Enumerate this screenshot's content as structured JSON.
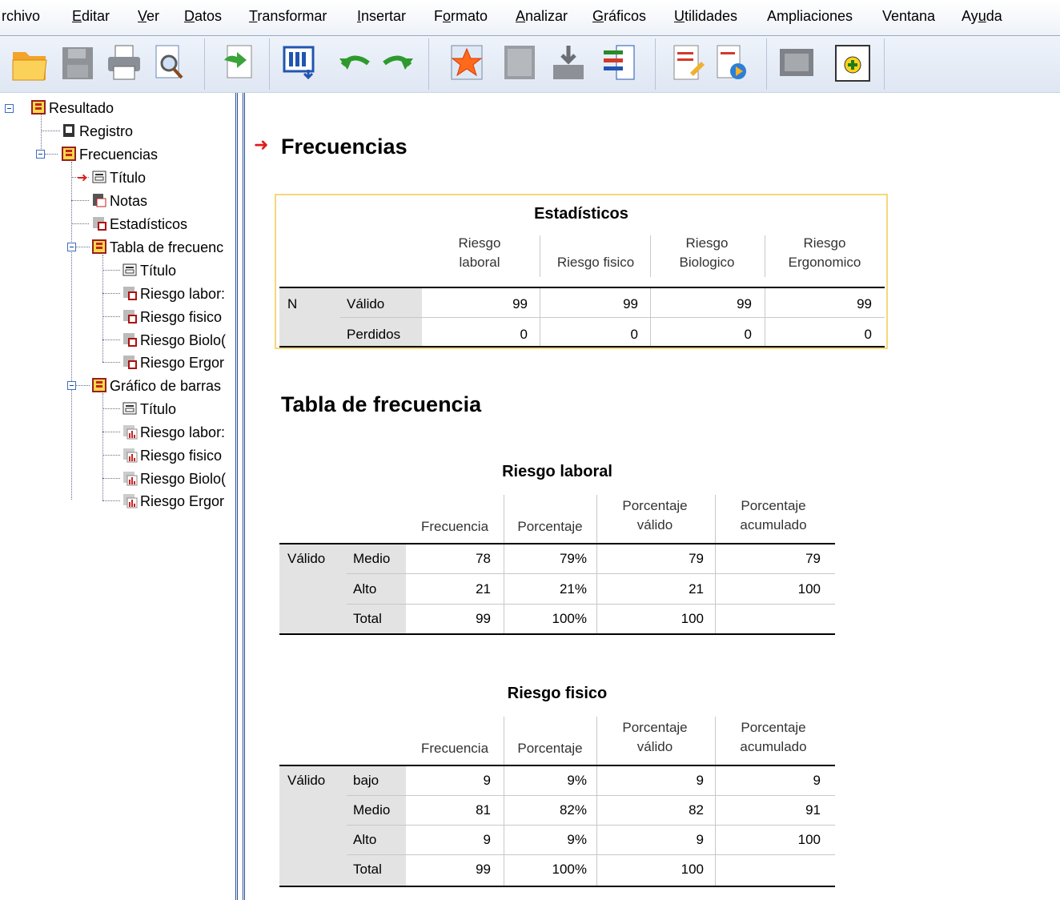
{
  "menu": [
    "rchivo",
    "Editar",
    "Ver",
    "Datos",
    "Transformar",
    "Insertar",
    "Formato",
    "Analizar",
    "Gráficos",
    "Utilidades",
    "Ampliaciones",
    "Ventana",
    "Ayuda"
  ],
  "toolbar_icons": [
    "open-folder-icon",
    "save-icon",
    "print-icon",
    "print-preview-icon",
    "export-icon",
    "recall-dialog-icon",
    "undo-icon",
    "redo-icon",
    "goto-data-icon",
    "goto-case-icon",
    "goto-variable-icon",
    "variables-icon",
    "create-title-icon",
    "insert-text-icon",
    "designate-window-icon",
    "add-icon"
  ],
  "tree": {
    "root": "Resultado",
    "log": "Registro",
    "freq": "Frecuencias",
    "title": "Título",
    "notes": "Notas",
    "stats": "Estadísticos",
    "freq_table": "Tabla de frecuenc",
    "ft_title": "Título",
    "ft_items": [
      "Riesgo labor:",
      "Riesgo fisico",
      "Riesgo Biolo(",
      "Riesgo Ergor"
    ],
    "bar_chart": "Gráfico de barras",
    "bc_title": "Título",
    "bc_items": [
      "Riesgo labor:",
      "Riesgo fisico",
      "Riesgo Biolo(",
      "Riesgo Ergor"
    ]
  },
  "output": {
    "heading": "Frecuencias",
    "stats": {
      "title": "Estadísticos",
      "cols": [
        "Riesgo laboral",
        "Riesgo fisico",
        "Riesgo Biologico",
        "Riesgo Ergonomico"
      ],
      "row_group": "N",
      "rows": [
        {
          "label": "Válido",
          "values": [
            "99",
            "99",
            "99",
            "99"
          ]
        },
        {
          "label": "Perdidos",
          "values": [
            "0",
            "0",
            "0",
            "0"
          ]
        }
      ]
    },
    "freq_heading": "Tabla de frecuencia",
    "col_headers": [
      "Frecuencia",
      "Porcentaje",
      "Porcentaje válido",
      "Porcentaje acumulado"
    ],
    "tables": [
      {
        "title": "Riesgo laboral",
        "group": "Válido",
        "rows": [
          {
            "label": "Medio",
            "values": [
              "78",
              "79%",
              "79",
              "79"
            ]
          },
          {
            "label": "Alto",
            "values": [
              "21",
              "21%",
              "21",
              "100"
            ]
          },
          {
            "label": "Total",
            "values": [
              "99",
              "100%",
              "100",
              ""
            ]
          }
        ]
      },
      {
        "title": "Riesgo fisico",
        "group": "Válido",
        "rows": [
          {
            "label": "bajo",
            "values": [
              "9",
              "9%",
              "9",
              "9"
            ]
          },
          {
            "label": "Medio",
            "values": [
              "81",
              "82%",
              "82",
              "91"
            ]
          },
          {
            "label": "Alto",
            "values": [
              "9",
              "9%",
              "9",
              "100"
            ]
          },
          {
            "label": "Total",
            "values": [
              "99",
              "100%",
              "100",
              ""
            ]
          }
        ]
      }
    ]
  }
}
